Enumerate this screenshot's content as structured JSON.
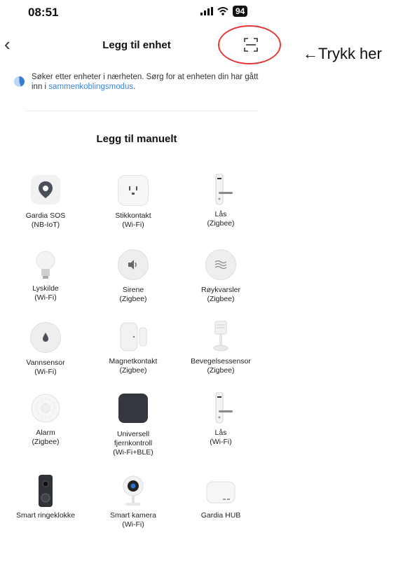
{
  "status_bar": {
    "time": "08:51",
    "battery": "94"
  },
  "header": {
    "title": "Legg til enhet",
    "back_glyph": "‹",
    "scan_icon": "scan-qr-icon"
  },
  "annotation": {
    "text": "←Trykk her",
    "color": "#e53935"
  },
  "notice": {
    "text": "Søker etter enheter i nærheten. Sørg for at enheten din har gått inn i ",
    "link": "sammenkoblingsmodus",
    "end": "."
  },
  "section_title": "Legg til manuelt",
  "devices": [
    {
      "label": "Gardia SOS\n(NB-IoT)",
      "icon": "location-pin-icon"
    },
    {
      "label": "Stikkontakt\n(Wi-Fi)",
      "icon": "power-outlet-icon"
    },
    {
      "label": "Lås\n(Zigbee)",
      "icon": "door-lock-icon"
    },
    {
      "label": "Lyskilde\n(Wi-Fi)",
      "icon": "light-bulb-icon"
    },
    {
      "label": "Sirene\n(Zigbee)",
      "icon": "siren-icon"
    },
    {
      "label": "Røykvarsler\n(Zigbee)",
      "icon": "smoke-detector-icon"
    },
    {
      "label": "Vannsensor\n(Wi-Fi)",
      "icon": "water-sensor-icon"
    },
    {
      "label": "Magnetkontakt\n(Zigbee)",
      "icon": "magnet-contact-icon"
    },
    {
      "label": "Bevegelsessensor\n(Zigbee)",
      "icon": "motion-sensor-icon"
    },
    {
      "label": "Alarm\n(Zigbee)",
      "icon": "alarm-icon"
    },
    {
      "label": "Universell\nfjernkontroll\n(Wi-Fi+BLE)",
      "icon": "remote-control-icon"
    },
    {
      "label": "Lås\n(Wi-Fi)",
      "icon": "door-lock-icon"
    },
    {
      "label": "Smart ringeklokke",
      "icon": "doorbell-icon"
    },
    {
      "label": "Smart kamera\n(Wi-Fi)",
      "icon": "camera-icon"
    },
    {
      "label": "Gardia HUB",
      "icon": "hub-icon"
    }
  ]
}
